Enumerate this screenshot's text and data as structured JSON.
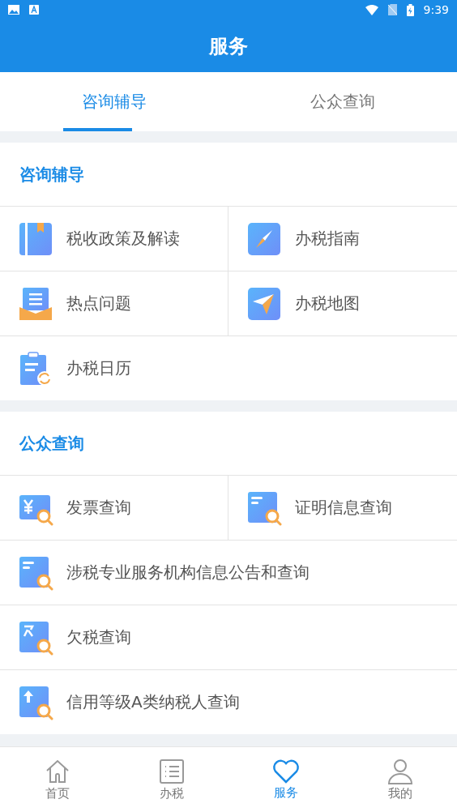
{
  "status_bar": {
    "time": "9:39"
  },
  "header": {
    "title": "服务"
  },
  "tabs": [
    {
      "label": "咨询辅导",
      "selected": true
    },
    {
      "label": "公众查询",
      "selected": false
    }
  ],
  "sections": [
    {
      "title": "咨询辅导",
      "rows": [
        [
          {
            "label": "税收政策及解读"
          },
          {
            "label": "办税指南"
          }
        ],
        [
          {
            "label": "热点问题"
          },
          {
            "label": "办税地图"
          }
        ],
        [
          {
            "label": "办税日历"
          }
        ]
      ]
    },
    {
      "title": "公众查询",
      "rows": [
        [
          {
            "label": "发票查询"
          },
          {
            "label": "证明信息查询"
          }
        ],
        [
          {
            "label": "涉税专业服务机构信息公告和查询"
          }
        ],
        [
          {
            "label": "欠税查询"
          }
        ],
        [
          {
            "label": "信用等级A类纳税人查询"
          }
        ]
      ]
    }
  ],
  "bottom_nav": [
    {
      "label": "首页",
      "selected": false
    },
    {
      "label": "办税",
      "selected": false
    },
    {
      "label": "服务",
      "selected": true
    },
    {
      "label": "我的",
      "selected": false
    }
  ]
}
